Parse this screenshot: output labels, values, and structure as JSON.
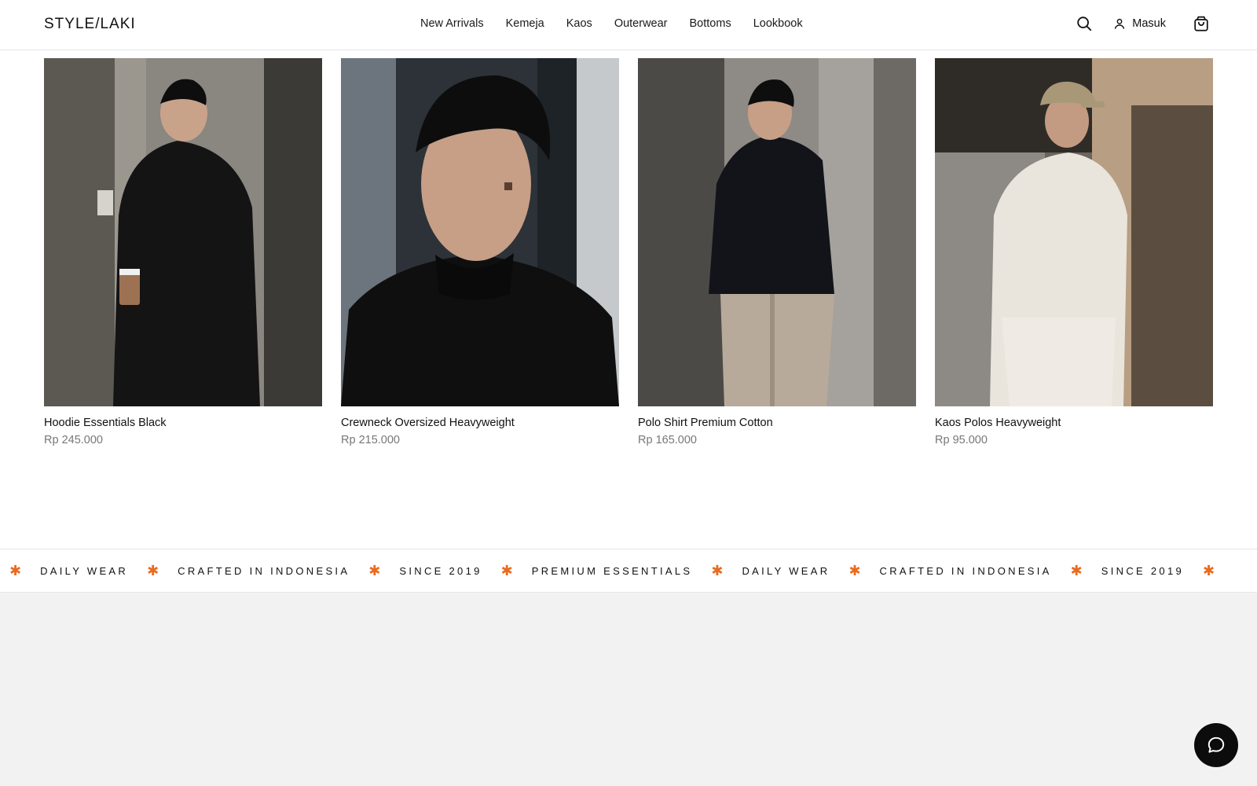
{
  "header": {
    "logo": "STYLE/LAKI",
    "nav": [
      "New Arrivals",
      "Kemeja",
      "Kaos",
      "Outerwear",
      "Bottoms",
      "Lookbook"
    ],
    "login_label": "Masuk",
    "icons": [
      "search-icon",
      "user-icon",
      "shopping-bag-icon"
    ]
  },
  "products": [
    {
      "name": "Hoodie Essentials Black",
      "price": "Rp 245.000"
    },
    {
      "name": "Crewneck Oversized Heavyweight",
      "price": "Rp 215.000"
    },
    {
      "name": "Polo Shirt Premium Cotton",
      "price": "Rp 165.000"
    },
    {
      "name": "Kaos Polos Heavyweight",
      "price": "Rp 95.000"
    }
  ],
  "marquee": {
    "items": [
      "DAILY WEAR",
      "CRAFTED IN INDONESIA",
      "SINCE 2019",
      "PREMIUM ESSENTIALS",
      "DAILY WEAR",
      "CRAFTED IN INDONESIA",
      "SINCE 2019"
    ],
    "separator": "✱",
    "accent_color": "#ea6a1f"
  },
  "chat": {
    "icon": "chat-bubble-icon"
  }
}
